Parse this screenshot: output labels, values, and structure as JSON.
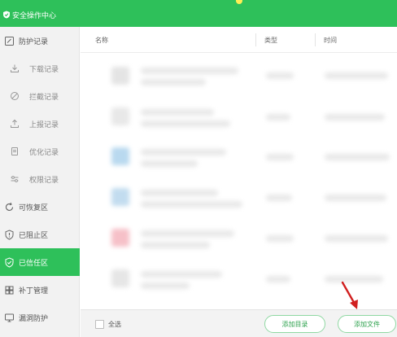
{
  "titlebar": {
    "title": "安全操作中心"
  },
  "sidebar": {
    "items": [
      {
        "label": "防护记录",
        "icon": "shield-record-icon"
      },
      {
        "label": "下载记录",
        "icon": "download-icon"
      },
      {
        "label": "拦截记录",
        "icon": "block-icon"
      },
      {
        "label": "上报记录",
        "icon": "upload-icon"
      },
      {
        "label": "优化记录",
        "icon": "document-icon"
      },
      {
        "label": "权限记录",
        "icon": "toggle-icon"
      },
      {
        "label": "可恢复区",
        "icon": "restore-icon"
      },
      {
        "label": "已阻止区",
        "icon": "blocked-shield-icon"
      },
      {
        "label": "已信任区",
        "icon": "trusted-shield-icon"
      },
      {
        "label": "补丁管理",
        "icon": "patch-grid-icon"
      },
      {
        "label": "漏洞防护",
        "icon": "monitor-icon"
      }
    ],
    "active_index": 8
  },
  "table": {
    "columns": [
      "名称",
      "类型",
      "时间"
    ]
  },
  "footer": {
    "select_all_label": "全选",
    "add_dir_label": "添加目录",
    "add_file_label": "添加文件"
  },
  "colors": {
    "accent": "#2ec05a",
    "active_bg": "#2ec05a",
    "button_text": "#2ea24e",
    "arrow": "#d11f1f"
  }
}
